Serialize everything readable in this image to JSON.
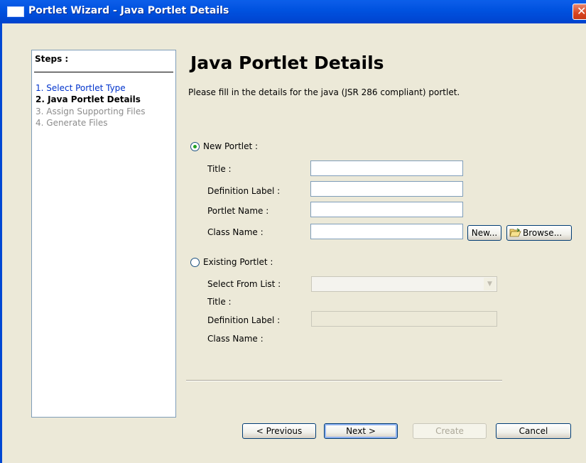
{
  "window": {
    "title": "Portlet Wizard - Java Portlet Details",
    "close_glyph": "✕"
  },
  "steps": {
    "title": "Steps :",
    "items": [
      {
        "label": "1. Select Portlet Type",
        "state": "done"
      },
      {
        "label": "2. Java Portlet Details",
        "state": "current"
      },
      {
        "label": "3. Assign Supporting Files",
        "state": "todo"
      },
      {
        "label": "4. Generate Files",
        "state": "todo"
      }
    ]
  },
  "main": {
    "heading": "Java Portlet Details",
    "subtitle": "Please fill in the details for the java (JSR 286 compliant) portlet.",
    "new_portlet": {
      "label": "New Portlet :",
      "selected": true,
      "fields": {
        "title_label": "Title :",
        "title_value": "",
        "definition_label": "Definition Label :",
        "definition_value": "",
        "portlet_name_label": "Portlet Name :",
        "portlet_name_value": "",
        "class_name_label": "Class Name :",
        "class_name_value": ""
      },
      "new_button": "New...",
      "browse_button": "Browse..."
    },
    "existing_portlet": {
      "label": "Existing Portlet :",
      "selected": false,
      "select_from_list_label": "Select From List :",
      "select_value": "",
      "title_label": "Title :",
      "definition_label": "Definition Label :",
      "definition_value": "",
      "class_name_label": "Class Name :"
    }
  },
  "footer": {
    "previous": "< Previous",
    "next": "Next >",
    "create": "Create",
    "cancel": "Cancel"
  },
  "colors": {
    "titlebar": "#0053e0",
    "step_done": "#0033cc",
    "step_todo": "#8c8c8c",
    "dialog_bg": "#ece9d8"
  }
}
